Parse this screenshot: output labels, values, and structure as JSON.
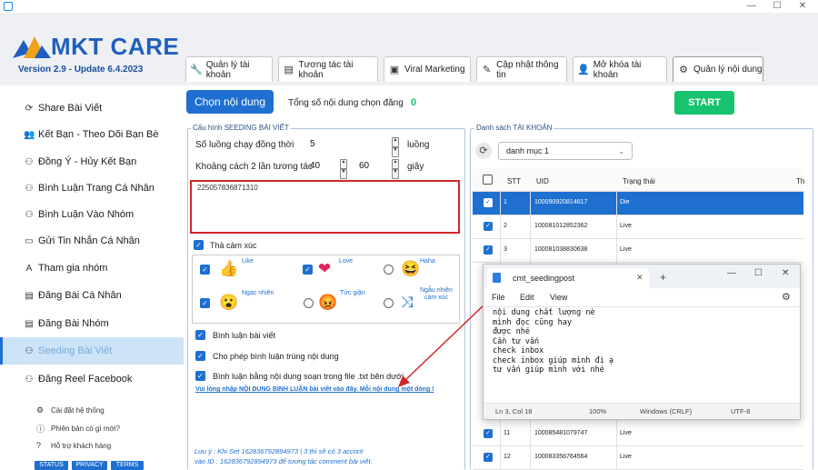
{
  "header": {
    "logo": "MKT CARE",
    "version": "Version 2.9 - Update 6.4.2023",
    "tabs": [
      {
        "label": "Quản lý tài khoản",
        "icon": "wrench-icon"
      },
      {
        "label": "Tương tác tài khoản",
        "icon": "list-icon"
      },
      {
        "label": "Viral Marketing",
        "icon": "window-icon"
      },
      {
        "label": "Cập nhật thông tin",
        "icon": "edit-icon"
      },
      {
        "label": "Mở khóa tài khoản",
        "icon": "user-icon"
      },
      {
        "label": "Quản lý nội dung",
        "icon": "content-icon"
      }
    ]
  },
  "sidebar": {
    "items": [
      {
        "label": "Share Bài Viết",
        "icon": "share-icon",
        "glyph": "⟳"
      },
      {
        "label": "Kết Bạn - Theo Dõi Bạn Bè",
        "icon": "add-friend-icon",
        "glyph": "👥"
      },
      {
        "label": "Đồng Ý - Hủy Kết Bạn",
        "icon": "friend-request-icon",
        "glyph": "⚇"
      },
      {
        "label": "Bình Luận Trang Cá Nhân",
        "icon": "comment-icon",
        "glyph": "⚇"
      },
      {
        "label": "Bình Luận Vào Nhóm",
        "icon": "group-comment-icon",
        "glyph": "⚇"
      },
      {
        "label": "Gửi Tin Nhắn Cá Nhân",
        "icon": "message-icon",
        "glyph": "▭"
      },
      {
        "label": "Tham gia nhóm",
        "icon": "join-group-icon",
        "glyph": "A"
      },
      {
        "label": "Đăng Bài Cá Nhân",
        "icon": "post-icon",
        "glyph": "▤"
      },
      {
        "label": "Đăng Bài Nhóm",
        "icon": "group-post-icon",
        "glyph": "▤"
      },
      {
        "label": "Seeding Bài Viết",
        "icon": "seeding-icon",
        "glyph": "⚇"
      },
      {
        "label": "Đăng Reel Facebook",
        "icon": "reel-icon",
        "glyph": "⚇"
      }
    ],
    "system": [
      {
        "label": "Cài đặt hệ thống",
        "icon": "gear-icon",
        "glyph": "⚙"
      },
      {
        "label": "Phiên bản có gì mới?",
        "icon": "info-icon",
        "glyph": "ⓘ"
      },
      {
        "label": "Hỗ trợ khách hàng",
        "icon": "help-icon",
        "glyph": "?"
      }
    ],
    "badges": [
      "STATUS",
      "PRIVACY",
      "TERMS"
    ]
  },
  "main": {
    "choose_content": "Chọn nội dung",
    "total_label": "Tổng số nội dung chọn đăng",
    "total_value": "0",
    "start": "START",
    "config_title": "Cấu hình SEEDING BÀI VIẾT",
    "threads_label": "Số luồng chạy đồng thời",
    "threads_value": "5",
    "threads_unit": "luồng",
    "interval_label": "Khoảng cách 2 lần tương tác",
    "interval_from": "40",
    "interval_to": "60",
    "interval_unit": "giây",
    "post_ids": "225057836871310",
    "react_label": "Thả cảm xúc",
    "reactions": [
      {
        "label": "Like",
        "emoji": "👍",
        "checked": true
      },
      {
        "label": "Love",
        "emoji": "❤",
        "checked": true
      },
      {
        "label": "Haha",
        "emoji": "😆",
        "checked": false
      },
      {
        "label": "Ngạc nhiên",
        "emoji": "😮",
        "checked": true
      },
      {
        "label": "Tức giận",
        "emoji": "😡",
        "checked": false
      },
      {
        "label": "Ngẫu nhiên cảm xúc",
        "emoji": "⤨",
        "checked": false
      }
    ],
    "options": [
      "Bình luận bài viết",
      "Cho phép bình luận trùng nội dung",
      "Bình luận bằng nội dung soạn trong file .txt bên dưới"
    ],
    "content_link": "Vui lòng nhập NỘI DUNG BÌNH LUẬN bài viết vào đây. Mỗi nội dung một dòng !",
    "note_line1": "Lưu ý : Khi Set 162836792894973 | 3 thì sẽ có 3 accont",
    "note_line2": "vào ID : 162836792894973 để tương tác comment bài viết."
  },
  "accounts": {
    "title": "Danh sách TÀI KHOẢN",
    "category": "danh mục 1",
    "columns": [
      "STT",
      "UID",
      "Trạng thái",
      "Th"
    ],
    "rows": [
      {
        "stt": "1",
        "uid": "100090920814617",
        "status": "Die",
        "selected": true
      },
      {
        "stt": "2",
        "uid": "100081012852362",
        "status": "Live",
        "selected": false
      },
      {
        "stt": "3",
        "uid": "100081038830638",
        "status": "Live",
        "selected": false
      },
      {
        "stt": "11",
        "uid": "100085481079747",
        "status": "Live",
        "selected": false
      },
      {
        "stt": "12",
        "uid": "100083356764564",
        "status": "Live",
        "selected": false
      }
    ]
  },
  "notepad": {
    "title": "cmt_seedingpost",
    "menu": [
      "File",
      "Edit",
      "View"
    ],
    "text": "nội dung chất lượng nè\nmình đọc cũng hay\nđược nhé\nCần tư vấn\ncheck inbox\ncheck inbox giúp mình đi ạ\ntư vấn giúp mình với nhé",
    "status": {
      "pos": "Ln 3, Col 18",
      "zoom": "100%",
      "eol": "Windows (CRLF)",
      "enc": "UTF-8"
    }
  },
  "colors": {
    "accent": "#1e6fd0",
    "start": "#17c36f",
    "highlight": "#d0262b"
  }
}
